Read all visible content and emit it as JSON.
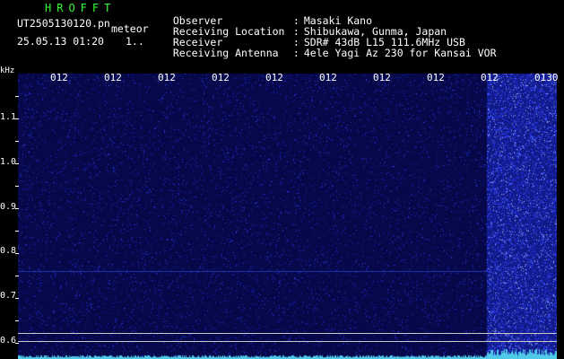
{
  "app": {
    "title": "HROFFT",
    "filename": "UT2505130120.pn",
    "type": "meteor",
    "timestamp": "25.05.13 01:20",
    "ellipsis": "1.."
  },
  "info": [
    {
      "label": "Observer",
      "value": "Masaki Kano"
    },
    {
      "label": "Receiving Location",
      "value": "Shibukawa, Gunma, Japan"
    },
    {
      "label": "Receiver",
      "value": "SDR# 43dB L15 111.6MHz USB"
    },
    {
      "label": "Receiving Antenna",
      "value": "4ele Yagi Az 230 for Kansai VOR"
    }
  ],
  "info_separator": ":",
  "spectrogram": {
    "unit_label": "kHz",
    "time_labels": [
      "012",
      "012",
      "012",
      "012",
      "012",
      "012",
      "012",
      "012",
      "012",
      "0130"
    ],
    "freq_labels": [
      "1.1",
      "1.0",
      "0.9",
      "0.8",
      "0.7",
      "0.6"
    ],
    "colors": {
      "background": "#06084a",
      "noise": "#2a3cff",
      "bright": "#b0c4ff",
      "trace": "#4ec9e8"
    }
  }
}
